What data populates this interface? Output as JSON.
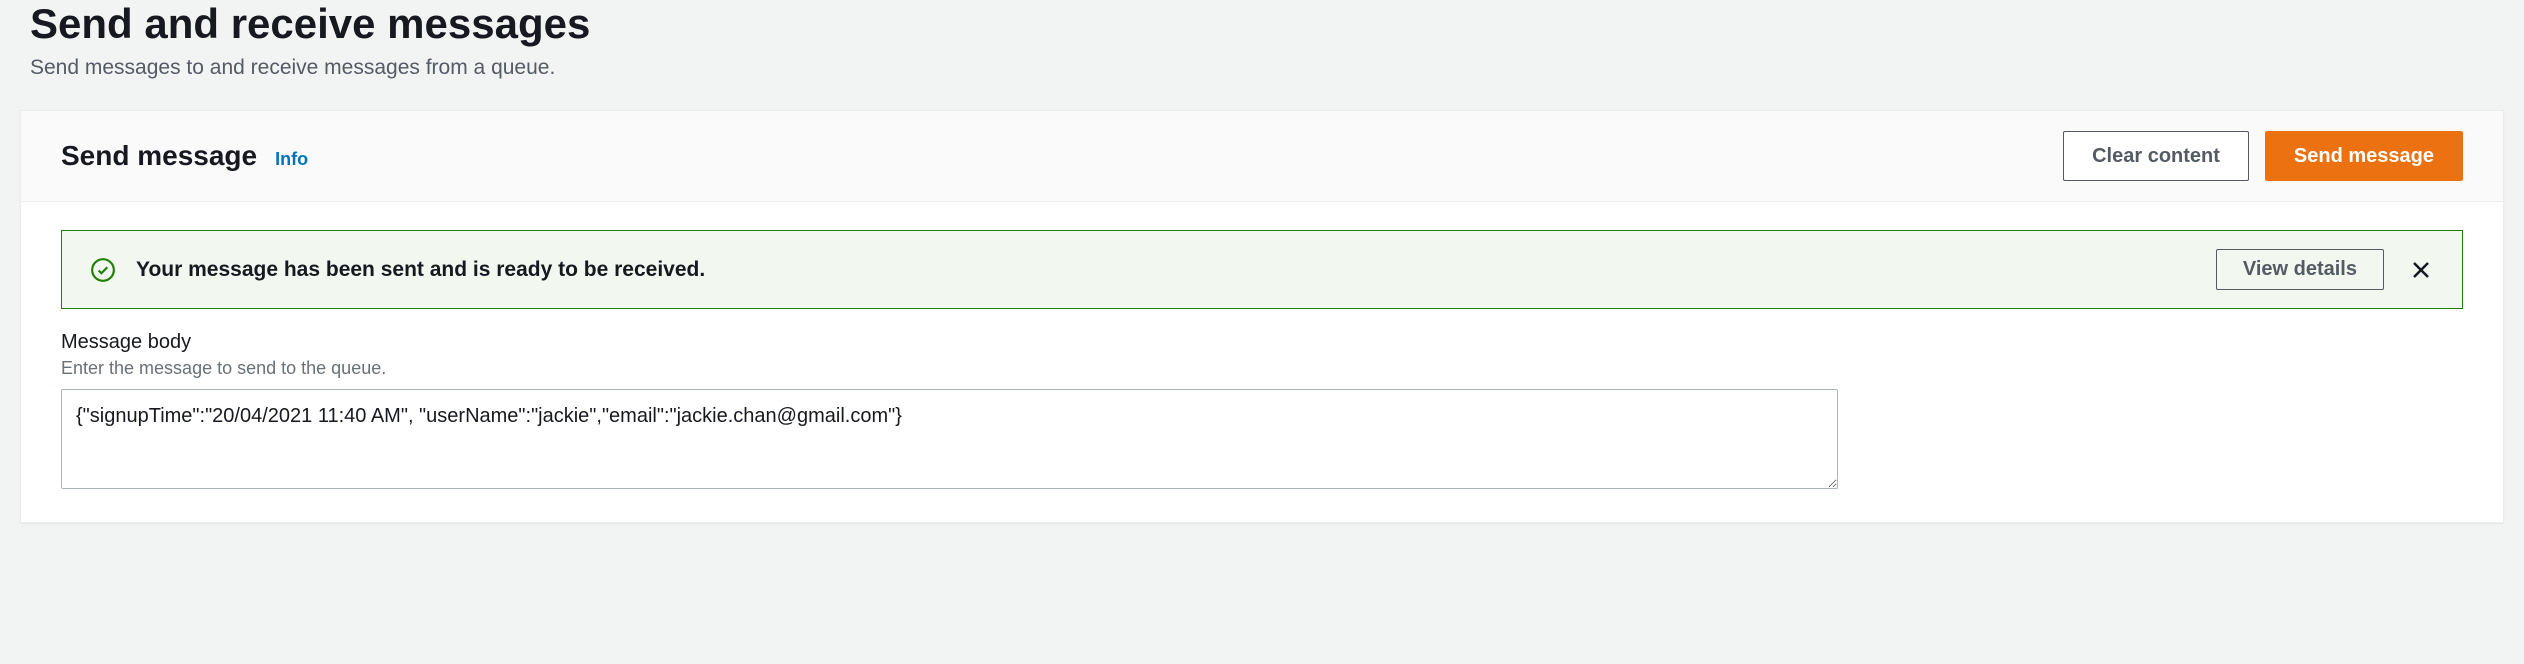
{
  "header": {
    "title": "Send and receive messages",
    "subtitle": "Send messages to and receive messages from a queue."
  },
  "panel": {
    "title": "Send message",
    "info_label": "Info",
    "clear_button": "Clear content",
    "send_button": "Send message"
  },
  "alert": {
    "text": "Your message has been sent and is ready to be received.",
    "view_details": "View details"
  },
  "form": {
    "body_label": "Message body",
    "body_hint": "Enter the message to send to the queue.",
    "body_value": "{\"signupTime\":\"20/04/2021 11:40 AM\", \"userName\":\"jackie\",\"email\":\"jackie.chan@gmail.com\"}"
  }
}
